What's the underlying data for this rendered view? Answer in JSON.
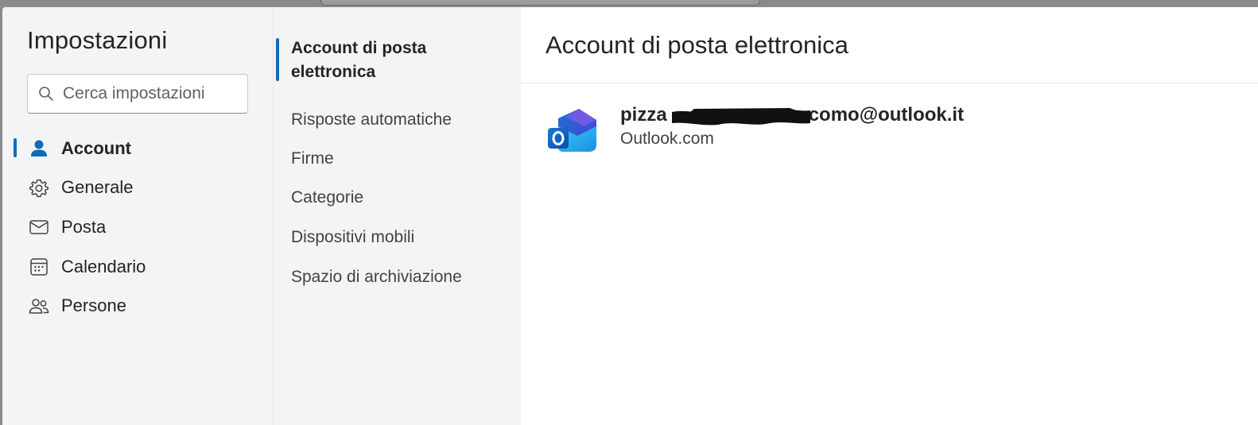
{
  "sidebar": {
    "title": "Impostazioni",
    "search": {
      "placeholder": "Cerca impostazioni",
      "value": ""
    },
    "items": [
      {
        "label": "Account",
        "icon": "person-icon",
        "active": true
      },
      {
        "label": "Generale",
        "icon": "gear-icon",
        "active": false
      },
      {
        "label": "Posta",
        "icon": "mail-icon",
        "active": false
      },
      {
        "label": "Calendario",
        "icon": "calendar-icon",
        "active": false
      },
      {
        "label": "Persone",
        "icon": "people-icon",
        "active": false
      }
    ]
  },
  "subnav": {
    "items": [
      {
        "label": "Account di posta elettronica",
        "active": true
      },
      {
        "label": "Risposte automatiche",
        "active": false
      },
      {
        "label": "Firme",
        "active": false
      },
      {
        "label": "Categorie",
        "active": false
      },
      {
        "label": "Dispositivi mobili",
        "active": false
      },
      {
        "label": "Spazio di archiviazione",
        "active": false
      }
    ]
  },
  "main": {
    "title": "Account di posta elettronica",
    "account": {
      "email_prefix": "pizza",
      "email_suffix": "como@outlook.it",
      "type": "Outlook.com",
      "icon": "outlook-logo-icon"
    }
  },
  "colors": {
    "accent": "#0f6cbd",
    "sidebar_bg": "#f4f4f4",
    "content_bg": "#ffffff",
    "outer_bg": "#8a8a8a"
  }
}
